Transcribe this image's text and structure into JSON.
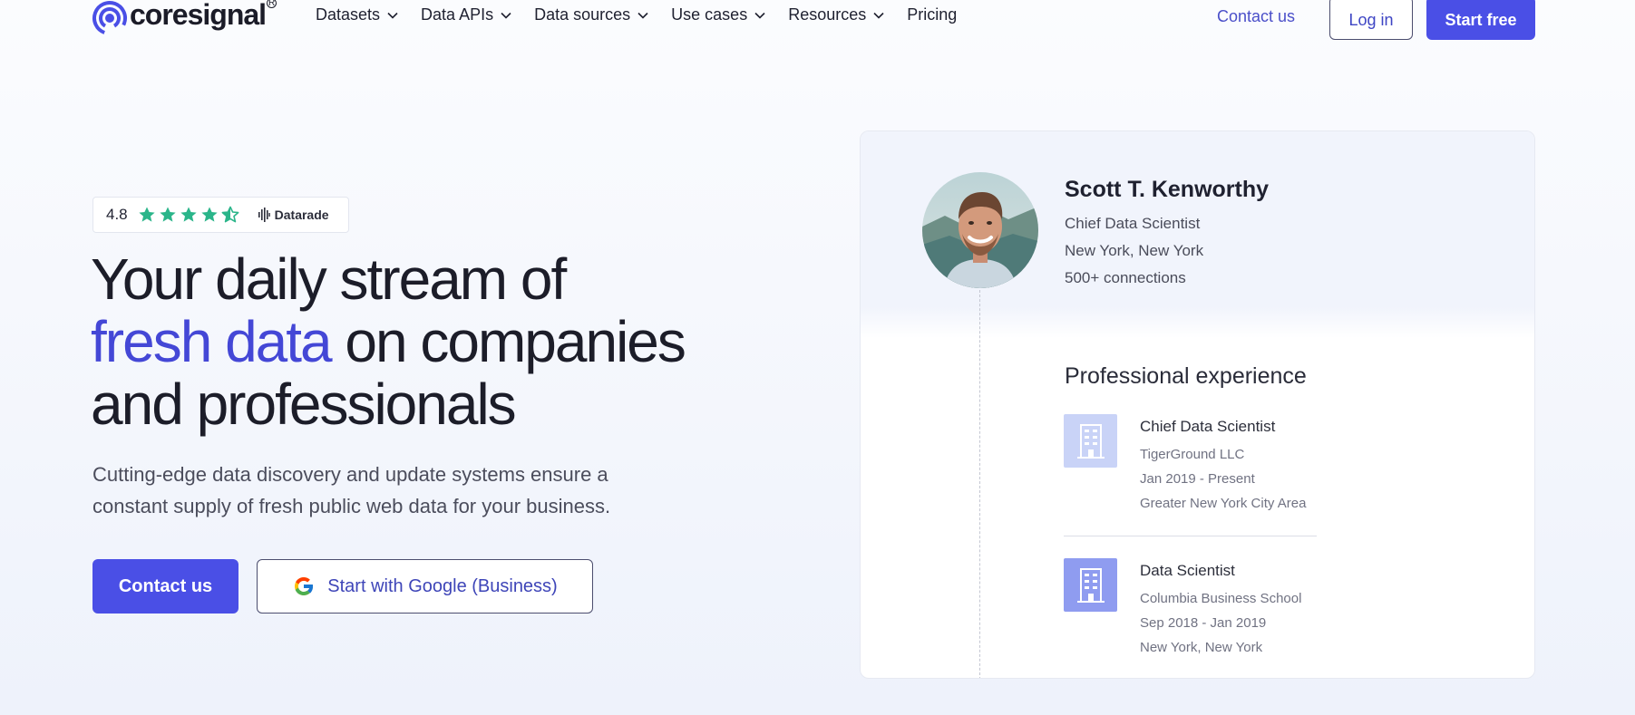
{
  "brand": {
    "name": "coresignal",
    "registered": "R",
    "accent_color": "#4a4fe6"
  },
  "nav": {
    "menu": [
      {
        "label": "Datasets",
        "has_dropdown": true
      },
      {
        "label": "Data APIs",
        "has_dropdown": true
      },
      {
        "label": "Data sources",
        "has_dropdown": true
      },
      {
        "label": "Use cases",
        "has_dropdown": true
      },
      {
        "label": "Resources",
        "has_dropdown": true
      },
      {
        "label": "Pricing",
        "has_dropdown": false
      }
    ],
    "contact_label": "Contact us",
    "login_label": "Log in",
    "start_label": "Start free"
  },
  "hero": {
    "rating": {
      "value": "4.8",
      "stars": 4.5,
      "max_stars": 5,
      "source": "Datarade",
      "star_color": "#2bb58a"
    },
    "headline": {
      "line1": "Your daily stream of",
      "accent": "fresh data",
      "line2_rest": " on companies",
      "line3": "and professionals"
    },
    "subtext": "Cutting-edge data discovery and update systems ensure a constant supply of fresh public web data for your business.",
    "contact_label": "Contact us",
    "google_label": "Start with Google (Business)"
  },
  "profile": {
    "name": "Scott T. Kenworthy",
    "title": "Chief Data Scientist",
    "location": "New York, New York",
    "connections": "500+ connections",
    "experience_title": "Professional experience",
    "experience": [
      {
        "role": "Chief Data Scientist",
        "company": "TigerGround LLC",
        "dates": "Jan 2019 - Present",
        "location": "Greater New York City Area",
        "icon_color": "#c9d3f7"
      },
      {
        "role": "Data Scientist",
        "company": "Columbia Business School",
        "dates": "Sep 2018 - Jan 2019",
        "location": "New York, New York",
        "icon_color": "#8f9cf0"
      }
    ]
  }
}
